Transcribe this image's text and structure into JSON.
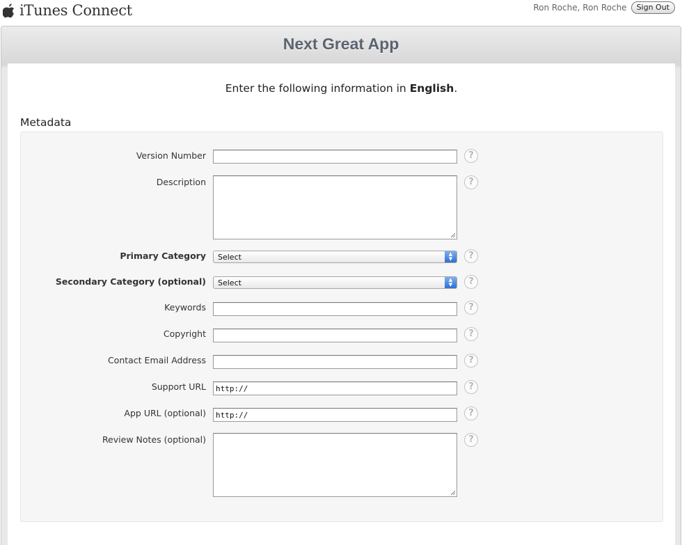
{
  "header": {
    "app_name": "iTunes Connect",
    "user_name": "Ron Roche, Ron Roche",
    "sign_out_label": "Sign Out"
  },
  "page": {
    "title": "Next Great App",
    "instruction_prefix": "Enter the following information in",
    "instruction_language": "English",
    "instruction_suffix": ".",
    "section_title": "Metadata"
  },
  "form": {
    "version_number": {
      "label": "Version Number",
      "value": ""
    },
    "description": {
      "label": "Description",
      "value": ""
    },
    "primary_category": {
      "label": "Primary Category",
      "selected": "Select"
    },
    "secondary_category": {
      "label": "Secondary Category (optional)",
      "selected": "Select"
    },
    "keywords": {
      "label": "Keywords",
      "value": ""
    },
    "copyright": {
      "label": "Copyright",
      "value": ""
    },
    "contact_email": {
      "label": "Contact Email Address",
      "value": ""
    },
    "support_url": {
      "label": "Support URL",
      "value": "http://"
    },
    "app_url": {
      "label": "App URL (optional)",
      "value": "http://"
    },
    "review_notes": {
      "label": "Review Notes (optional)",
      "value": ""
    }
  },
  "help_glyph": "?",
  "icons": {
    "logo": "apple-logo-icon",
    "help": "help-question-icon",
    "select": "select-arrows-icon"
  },
  "colors": {
    "title_text": "#5a6470",
    "select_accent": "#2f6fd4"
  }
}
